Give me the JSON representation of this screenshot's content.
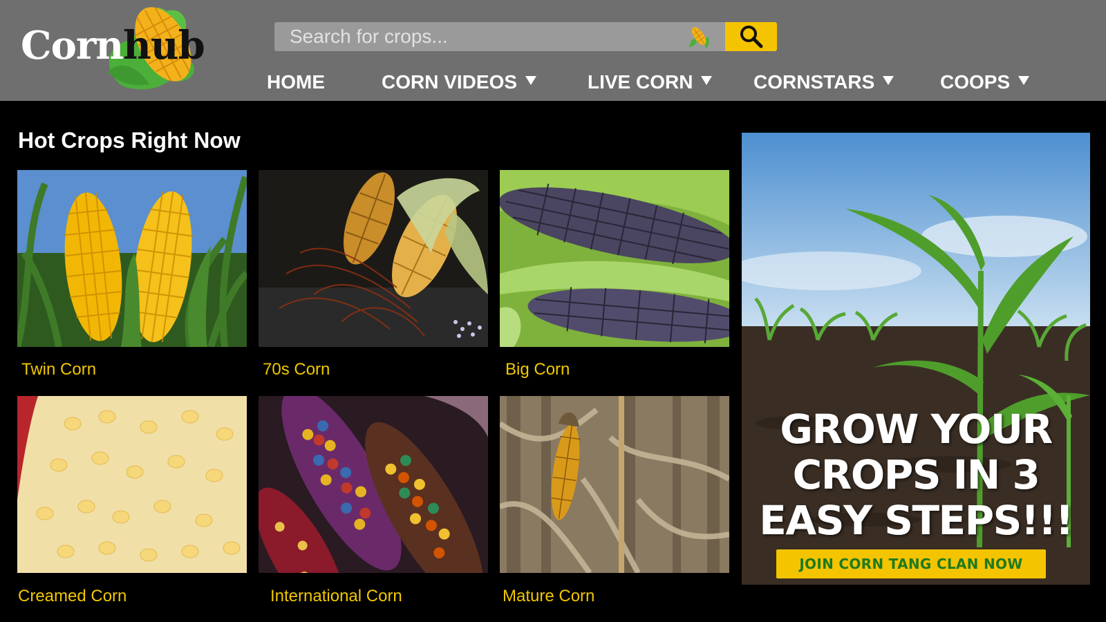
{
  "brand": {
    "logo_corn": "Corn",
    "logo_hub": "hub"
  },
  "search": {
    "placeholder": "Search for crops..."
  },
  "nav": {
    "home": "HOME",
    "corn_videos": "CORN VIDEOS",
    "live_corn": "LIVE CORN",
    "cornstars": "CORNSTARS",
    "coops": "COOPS"
  },
  "main": {
    "title": "Hot Crops Right Now",
    "tiles": [
      {
        "caption": "Twin Corn"
      },
      {
        "caption": "70s Corn"
      },
      {
        "caption": "Big Corn"
      },
      {
        "caption": "Creamed Corn"
      },
      {
        "caption": "International Corn"
      },
      {
        "caption": "Mature Corn"
      }
    ]
  },
  "ad": {
    "headline_1": "GROW YOUR",
    "headline_2": "CROPS IN 3",
    "headline_3": "EASY STEPS!!!",
    "cta": "JOIN CORN TANG CLAN NOW"
  },
  "colors": {
    "header": "#6f6f6f",
    "accent": "#f5c400",
    "caption": "#f0c800",
    "background": "#000000"
  },
  "icons": {
    "search": "magnifier-icon",
    "corn": "corn-icon"
  }
}
